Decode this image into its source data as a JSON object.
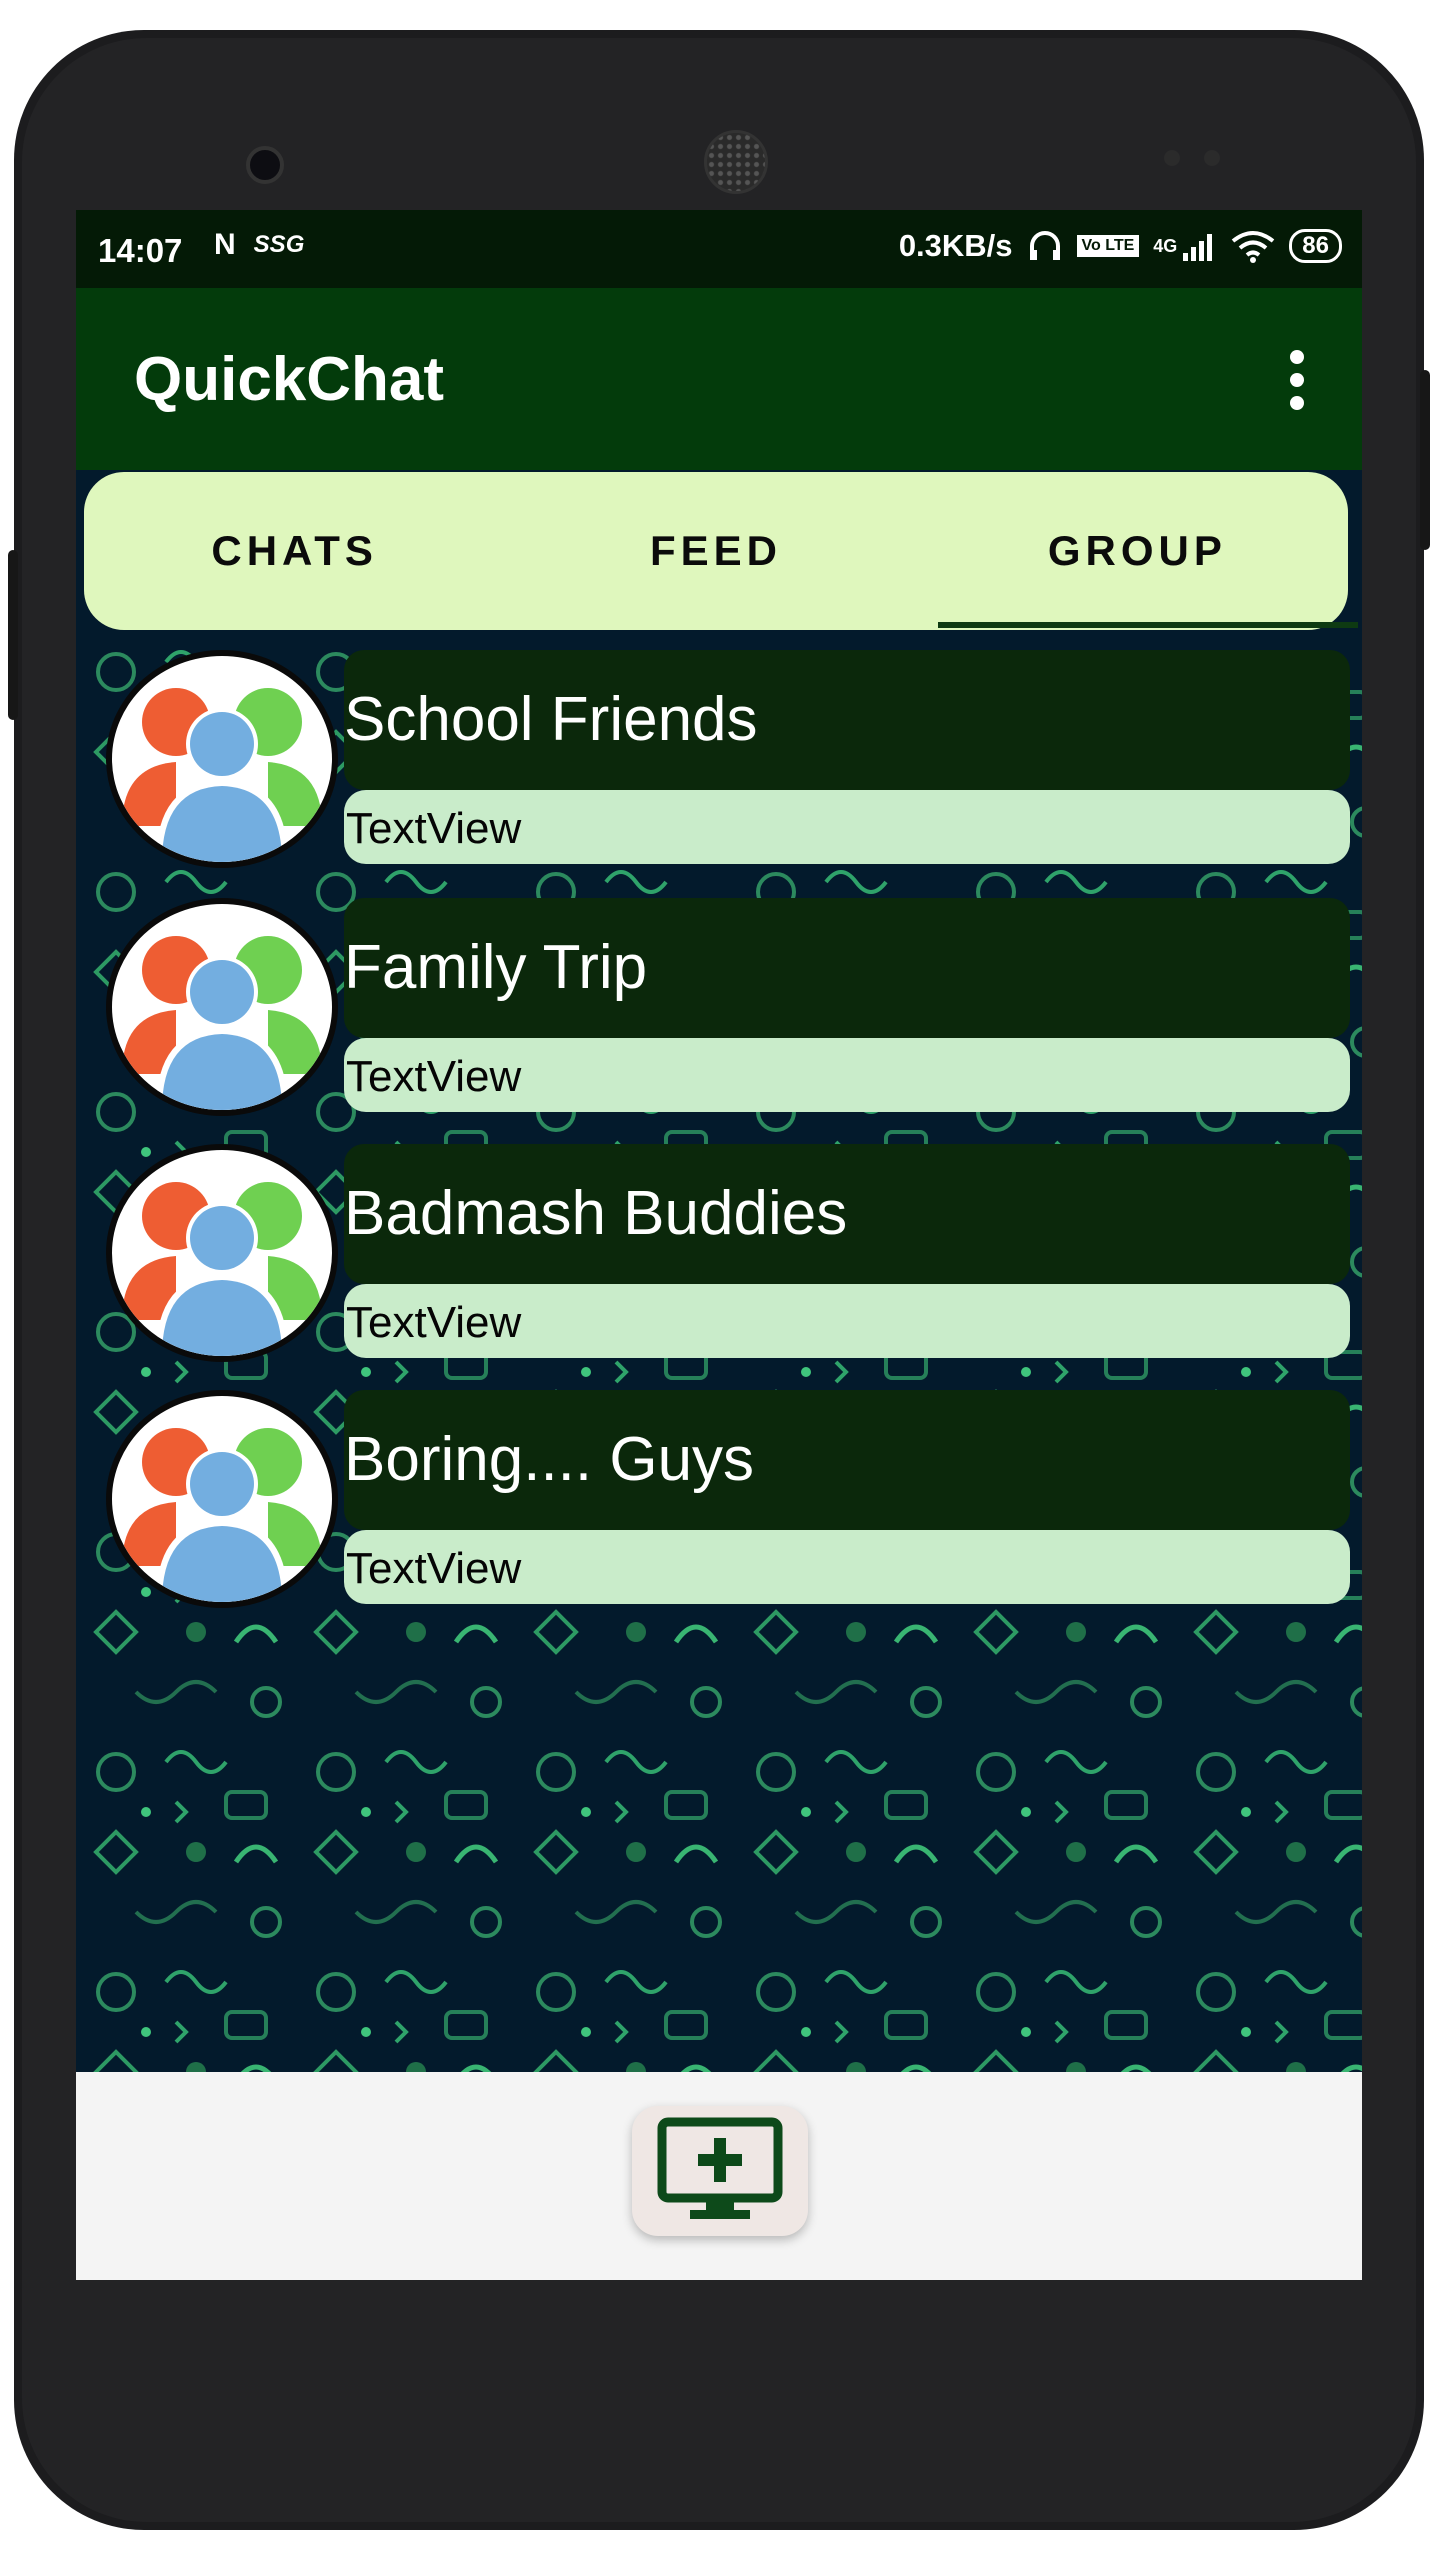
{
  "status_bar": {
    "time": "14:07",
    "carrier_icons": [
      "N",
      "SSG"
    ],
    "speed": "0.3KB/s",
    "network_label": "4G",
    "volte_label": "Vo LTE",
    "battery": "86"
  },
  "app_bar": {
    "title": "QuickChat",
    "menu_icon": "overflow-menu-icon"
  },
  "tabs": [
    {
      "label": "CHATS",
      "selected": false
    },
    {
      "label": "FEED",
      "selected": false
    },
    {
      "label": "GROUP",
      "selected": true
    }
  ],
  "groups": [
    {
      "name": "School Friends",
      "last_message": "TextView"
    },
    {
      "name": "Family Trip",
      "last_message": "TextView"
    },
    {
      "name": "Badmash Buddies",
      "last_message": "TextView"
    },
    {
      "name": "Boring.... Guys",
      "last_message": "TextView"
    }
  ],
  "fab": {
    "icon": "add-screen-icon"
  },
  "colors": {
    "app_bar": "#033b0b",
    "tab_bg": "#dff7bd",
    "name_box": "#0b280b",
    "msg_box": "#c9ecca",
    "accent": "#0e3a12"
  }
}
